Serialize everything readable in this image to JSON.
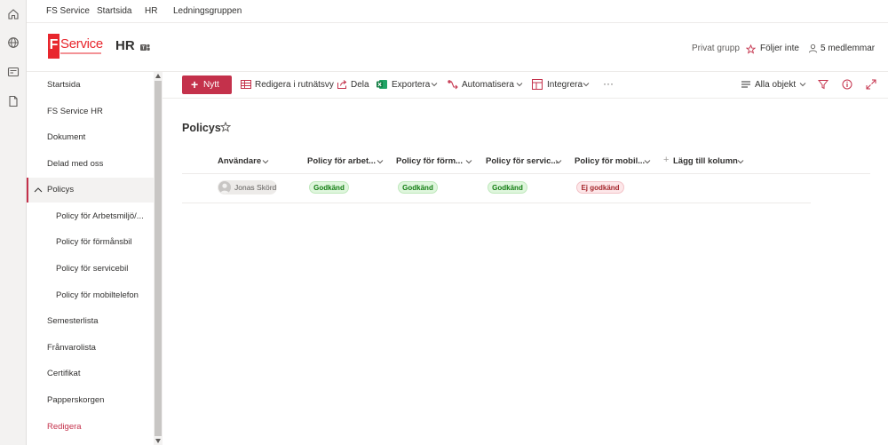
{
  "hub_nav": {
    "links": [
      "FS Service",
      "Startsida",
      "HR",
      "Ledningsgruppen"
    ]
  },
  "site_header": {
    "logo_letter": "F",
    "logo_text": "Service",
    "title": "HR",
    "private_group": "Privat grupp",
    "follow": "Följer inte",
    "members": "5 medlemmar"
  },
  "left_nav": {
    "items": [
      {
        "label": "Startsida"
      },
      {
        "label": "FS Service HR"
      },
      {
        "label": "Dokument"
      },
      {
        "label": "Delad med oss"
      },
      {
        "label": "Policys"
      },
      {
        "label": "Policy för Arbetsmiljö/..."
      },
      {
        "label": "Policy för förmånsbil"
      },
      {
        "label": "Policy för servicebil"
      },
      {
        "label": "Policy för mobiltelefon"
      },
      {
        "label": "Semesterlista"
      },
      {
        "label": "Frånvarolista"
      },
      {
        "label": "Certifikat"
      },
      {
        "label": "Papperskorgen"
      },
      {
        "label": "Redigera"
      }
    ]
  },
  "command_bar": {
    "new_label": "Nytt",
    "grid_edit": "Redigera i rutnätsvy",
    "share": "Dela",
    "export": "Exportera",
    "automate": "Automatisera",
    "integrate": "Integrera",
    "more": "···",
    "view": "Alla objekt"
  },
  "list": {
    "title": "Policys",
    "columns": [
      "Användare",
      "Policy för arbet...",
      "Policy för förm...",
      "Policy för servic...",
      "Policy för mobil...",
      "Lägg till kolumn"
    ],
    "rows": [
      {
        "user": "Jonas Skörd",
        "arbetsmiljo": "Godkänd",
        "formansbil": "Godkänd",
        "servicebil": "Godkänd",
        "mobiltelefon": "Ej godkänd"
      }
    ]
  },
  "colors": {
    "accent": "#c4314b",
    "approved_bg": "#dff6dd",
    "approved_text": "#107c10",
    "rejected_bg": "#fde7e9",
    "rejected_text": "#a4262c"
  }
}
